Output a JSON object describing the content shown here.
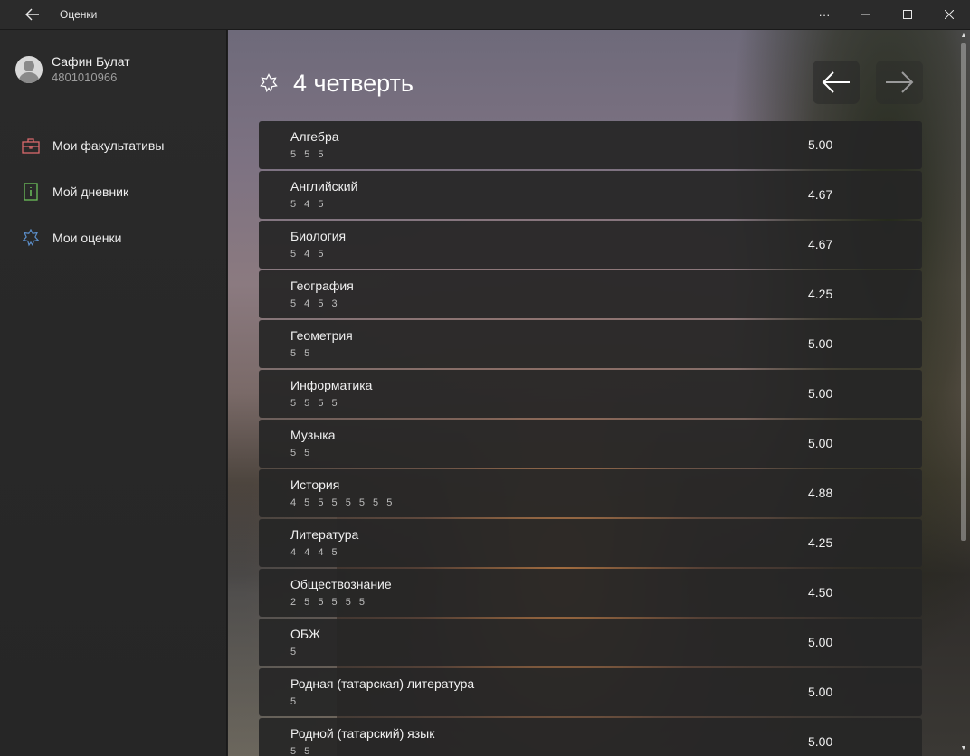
{
  "window": {
    "title": "Оценки",
    "more_glyph": "···"
  },
  "sidebar": {
    "user_name": "Сафин Булат",
    "user_id": "4801010966",
    "items": [
      {
        "label": "Мои факультативы",
        "icon": "briefcase-icon",
        "color": "#d9686c"
      },
      {
        "label": "Мой дневник",
        "icon": "diary-icon",
        "color": "#6bbf5a"
      },
      {
        "label": "Мои оценки",
        "icon": "star-icon",
        "color": "#5b8ec9"
      }
    ]
  },
  "main": {
    "title": "4 четверть",
    "subjects": [
      {
        "name": "Алгебра",
        "grades": "5 5 5",
        "average": "5.00"
      },
      {
        "name": "Английский",
        "grades": "5 4 5",
        "average": "4.67"
      },
      {
        "name": "Биология",
        "grades": "5 4 5",
        "average": "4.67"
      },
      {
        "name": "География",
        "grades": "5 4 5 3",
        "average": "4.25"
      },
      {
        "name": "Геометрия",
        "grades": "5 5",
        "average": "5.00"
      },
      {
        "name": "Информатика",
        "grades": "5 5 5 5",
        "average": "5.00"
      },
      {
        "name": "Музыка",
        "grades": "5 5",
        "average": "5.00"
      },
      {
        "name": "История",
        "grades": "4 5 5 5 5 5 5 5",
        "average": "4.88"
      },
      {
        "name": "Литература",
        "grades": "4 4 4 5",
        "average": "4.25"
      },
      {
        "name": "Обществознание",
        "grades": "2 5 5 5 5 5",
        "average": "4.50"
      },
      {
        "name": "ОБЖ",
        "grades": "5",
        "average": "5.00"
      },
      {
        "name": "Родная (татарская) литература",
        "grades": "5",
        "average": "5.00"
      },
      {
        "name": "Родной (татарский) язык",
        "grades": "5 5",
        "average": "5.00"
      }
    ]
  }
}
